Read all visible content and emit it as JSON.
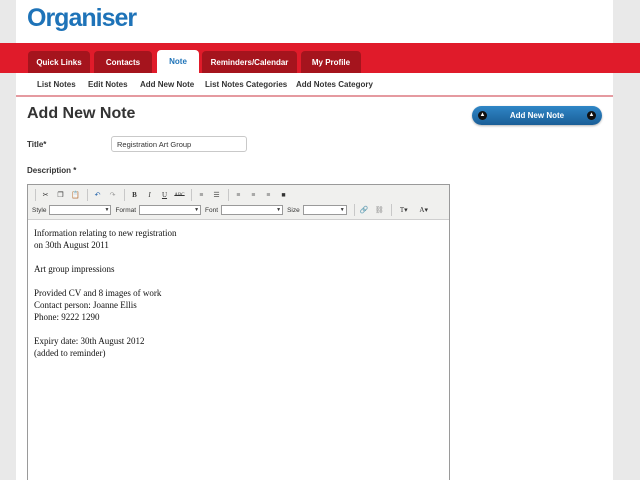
{
  "app": {
    "logo": "Organiser"
  },
  "tabs": [
    {
      "label": "Quick Links",
      "active": false
    },
    {
      "label": "Contacts",
      "active": false
    },
    {
      "label": "Note",
      "active": true
    },
    {
      "label": "Reminders/Calendar",
      "active": false
    },
    {
      "label": "My Profile",
      "active": false
    }
  ],
  "subnav": [
    {
      "label": "List Notes"
    },
    {
      "label": "Edit Notes"
    },
    {
      "label": "Add New Note"
    },
    {
      "label": "List Notes Categories"
    },
    {
      "label": "Add Notes Category"
    }
  ],
  "page": {
    "title": "Add New Note",
    "add_button_label": "Add New Note"
  },
  "form": {
    "title_label": "Title*",
    "title_value": "Registration Art Group",
    "description_label": "Description *"
  },
  "editor": {
    "toolbar": {
      "style_label": "Style",
      "format_label": "Format",
      "font_label": "Font",
      "size_label": "Size"
    },
    "lines": [
      "Information relating to new registration",
      "on 30th August 2011",
      "",
      "Art group impressions",
      "",
      "Provided CV and 8 images of work",
      "Contact person: Joanne Ellis",
      "Phone: 9222 1290",
      "",
      "Expiry date: 30th August 2012",
      "(added to reminder)"
    ]
  },
  "colors": {
    "brand_blue": "#1e73b8",
    "nav_red": "#e01b2a",
    "tab_dark_red": "#a5141d"
  }
}
